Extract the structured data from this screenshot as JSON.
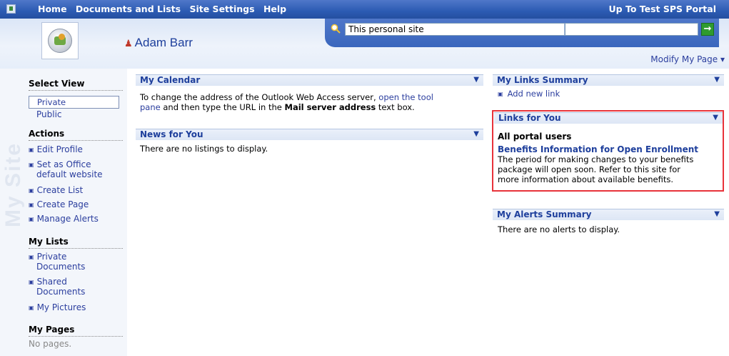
{
  "topnav": {
    "links": [
      "Home",
      "Documents and Lists",
      "Site Settings",
      "Help"
    ],
    "portal": "Up To Test SPS Portal"
  },
  "header": {
    "user_name": "Adam Barr",
    "search_scope": "This personal site",
    "search_value": "",
    "go_label": "→",
    "modify_page": "Modify My Page ▾"
  },
  "leftnav": {
    "watermark": "My Site",
    "select_view": "Select View",
    "view_private": "Private",
    "view_public": "Public",
    "actions_title": "Actions",
    "actions": [
      "Edit Profile",
      "Set as Office",
      "default website",
      "Create List",
      "Create Page",
      "Manage Alerts"
    ],
    "lists_title": "My Lists",
    "lists": [
      "Private",
      "Documents",
      "Shared",
      "Documents",
      "My Pictures"
    ],
    "pages_title": "My Pages",
    "no_pages": "No pages."
  },
  "calendar": {
    "title": "My Calendar",
    "text_before_link": "To change the address of the Outlook Web Access server, ",
    "link1": "open the tool",
    "link2": "pane",
    "text_mid": " and then type the URL in the ",
    "bold": "Mail server address",
    "text_end": " text box."
  },
  "news": {
    "title": "News for You",
    "empty": "There are no listings to display."
  },
  "links_summary": {
    "title": "My Links Summary",
    "add_link": "Add new link"
  },
  "links_for_you": {
    "title": "Links for You",
    "audience": "All portal users",
    "item_title": "Benefits Information for Open Enrollment",
    "desc": [
      "The period for making changes to your benefits",
      "package will open soon. Refer to this site for",
      "more information about available benefits."
    ]
  },
  "alerts": {
    "title": "My Alerts Summary",
    "empty": "There are no alerts to display."
  },
  "icons": {
    "dropdown": "▼",
    "bullet": "▣",
    "person": "♟"
  },
  "colors": {
    "nav_blue": "#2c5bb3",
    "title_blue": "#1e3f9c",
    "highlight_red": "#e8333a"
  }
}
